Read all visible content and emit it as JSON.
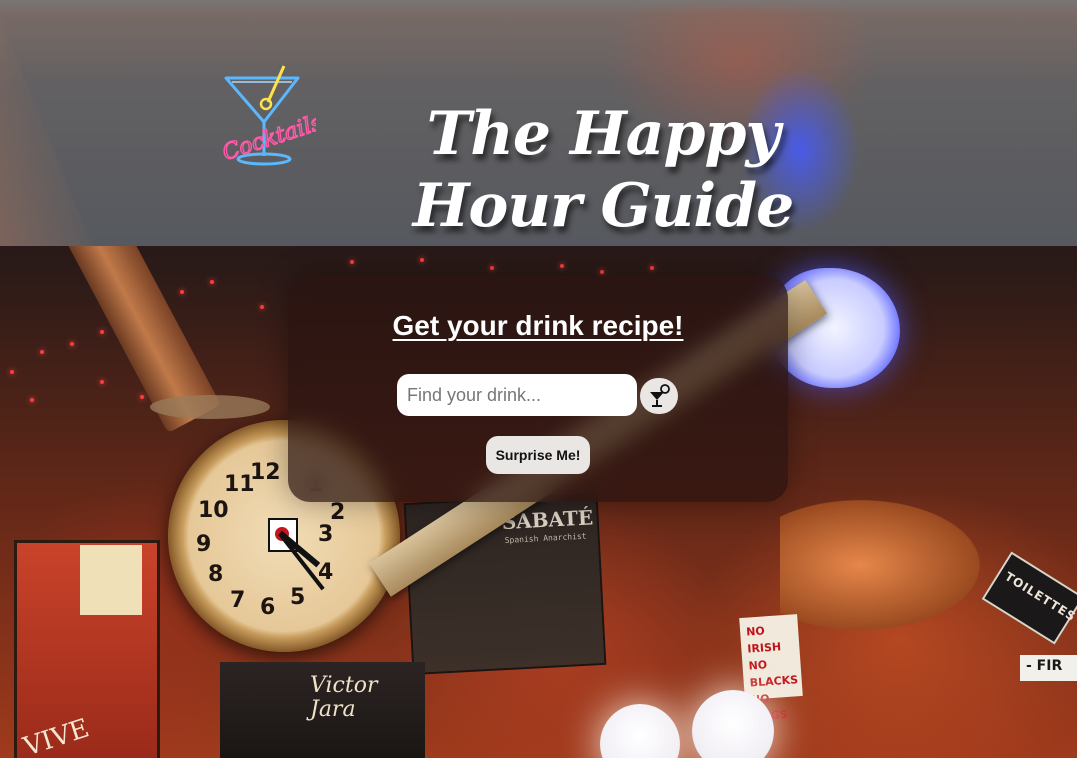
{
  "header": {
    "title": "The Happy Hour Guide",
    "logo_text": "Cocktails",
    "logo_icon": "martini-glass-neon-icon"
  },
  "search_card": {
    "heading": "Get your drink recipe!",
    "search_placeholder": "Find your drink...",
    "search_value": "",
    "search_button_icon": "cocktail-search-icon",
    "surprise_label": "Surprise Me!"
  },
  "background": {
    "clock_numbers": [
      "12",
      "1",
      "2",
      "3",
      "4",
      "5",
      "6",
      "7",
      "8",
      "9",
      "10",
      "11"
    ],
    "poster_sabate_title": "SABATÉ",
    "poster_sabate_subtitle": "Spanish Anarchist",
    "poster_victor_text": "Victor Jara",
    "poster_vive": "VIVE",
    "sign_noirish": "NO IRISH NO BLACKS NO DOGS",
    "sign_toilettes": "TOILETTES",
    "sign_fir": "- FIR"
  },
  "colors": {
    "card_background": "#2a1410",
    "button_background": "#e9e6e4",
    "title_text": "#ffffff",
    "neon_pink": "#ff5aa8",
    "neon_blue": "#5ab8ff",
    "neon_yellow": "#ffe14a"
  }
}
